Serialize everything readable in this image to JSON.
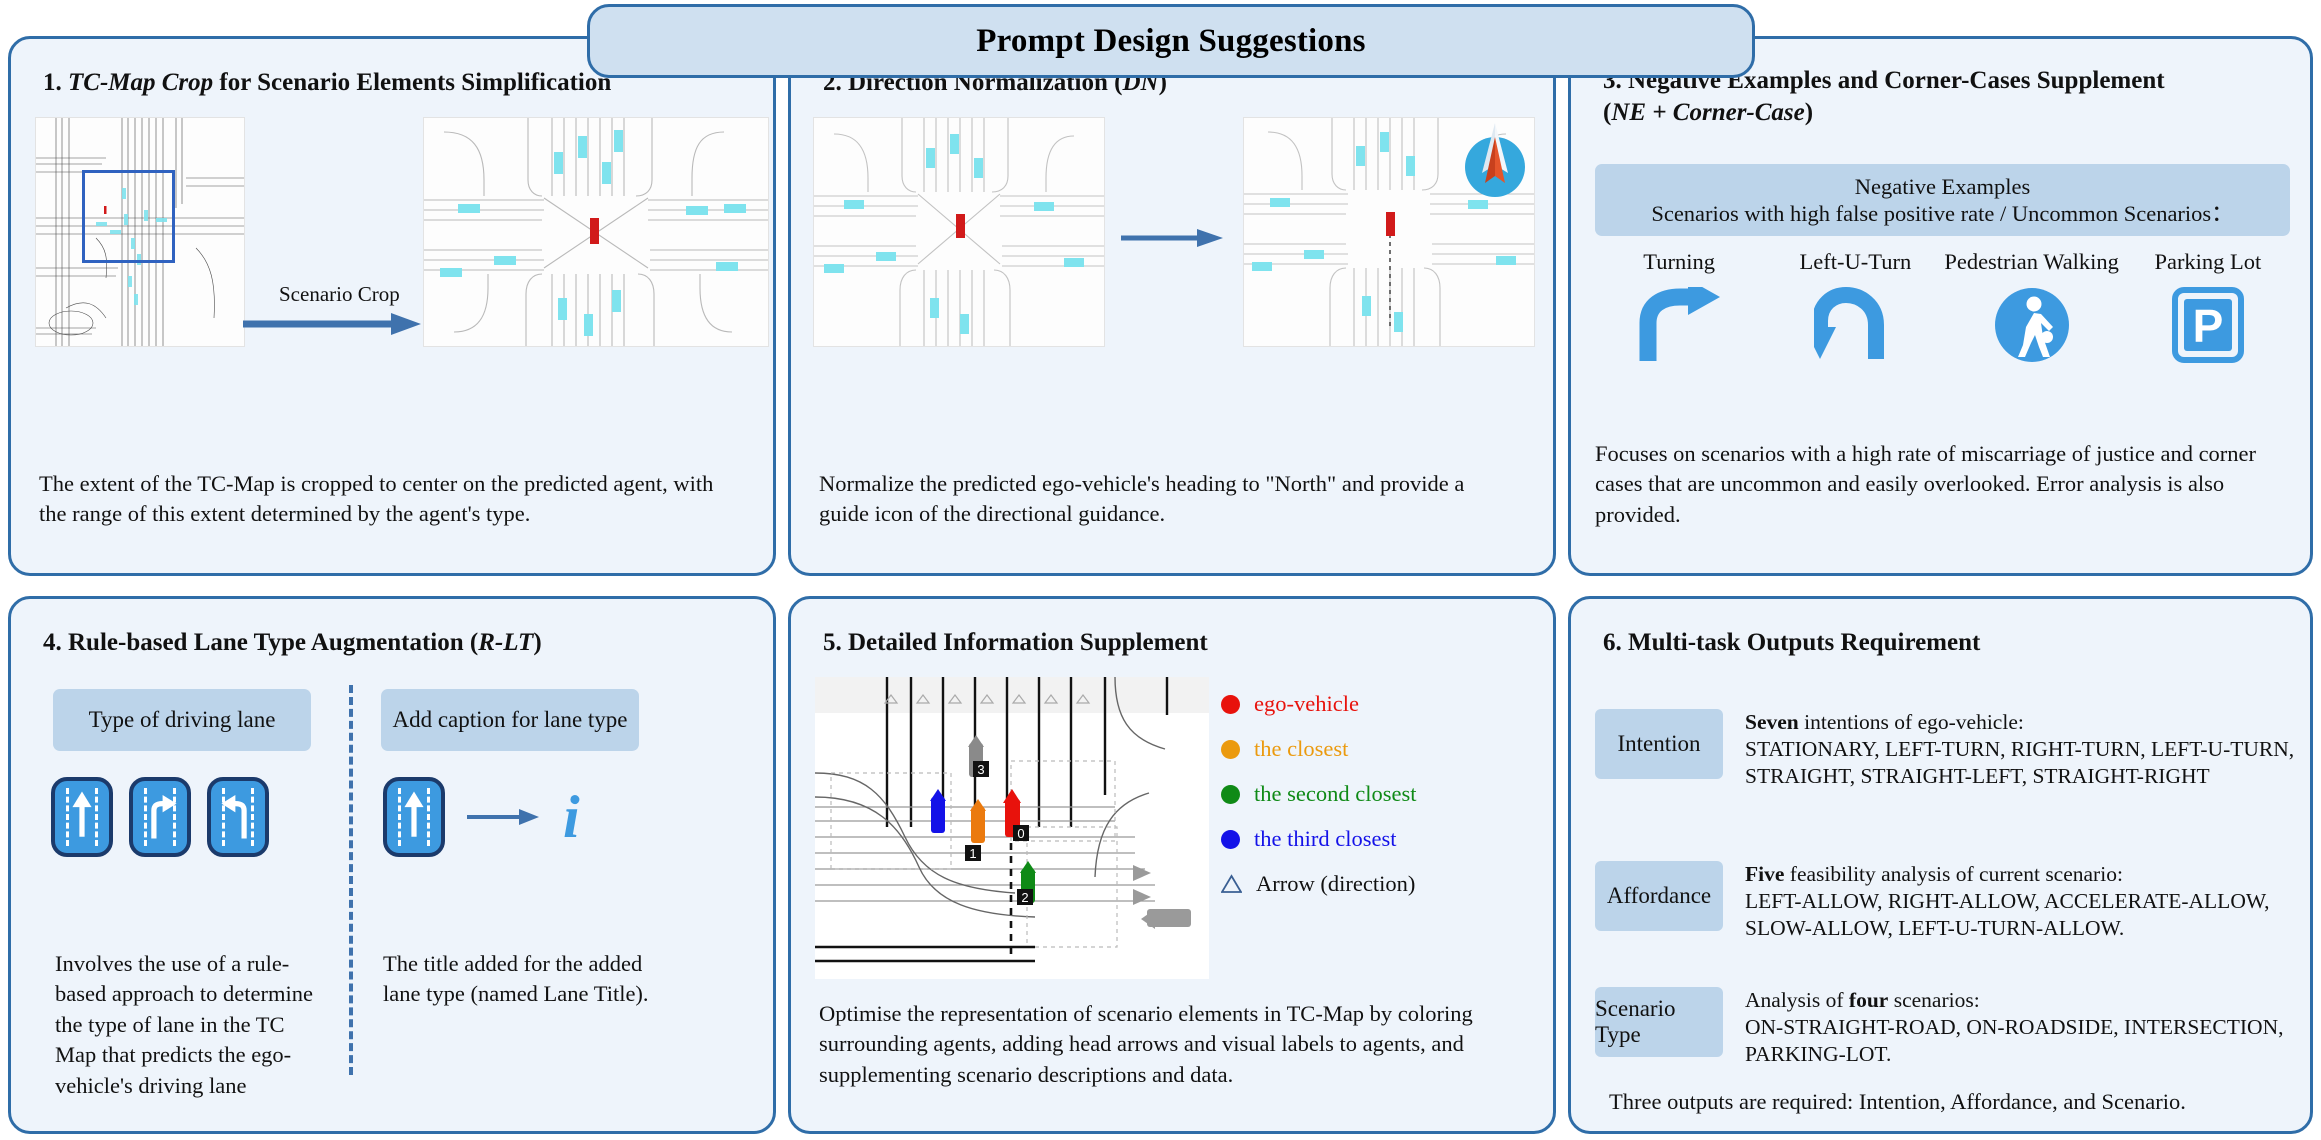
{
  "header": {
    "title": "Prompt Design Suggestions"
  },
  "panels": {
    "p1": {
      "title_num": "1.",
      "title_ital": "TC-Map Crop",
      "title_rest": "for Scenario Elements Simplification",
      "crop_label": "Scenario Crop",
      "caption": "The extent of the TC-Map is cropped to center on the predicted agent, with the range of this extent determined by the agent's type."
    },
    "p2": {
      "title_num": "2.",
      "title_rest": "Direction Normalization (",
      "title_ital": "DN",
      "title_tail": ")",
      "caption": "Normalize the predicted ego-vehicle's heading to \"North\" and provide a guide icon of the directional guidance."
    },
    "p3": {
      "title_num": "3.",
      "title_rest": "Negative Examples and Corner-Cases Supplement",
      "title_line2_open": "(",
      "title_line2_ital": "NE + Corner-Case",
      "title_line2_close": ")",
      "box_line1": "Negative Examples",
      "box_line2": "Scenarios with high false positive rate / Uncommon Scenarios：",
      "icons": [
        {
          "label": "Turning",
          "icon": "turn-right-arrow-icon"
        },
        {
          "label": "Left-U-Turn",
          "icon": "left-u-turn-arrow-icon"
        },
        {
          "label": "Pedestrian Walking",
          "icon": "pedestrian-walking-icon"
        },
        {
          "label": "Parking Lot",
          "icon": "parking-sign-icon"
        }
      ],
      "caption": "Focuses on scenarios with a high rate of miscarriage of justice and corner cases that are uncommon and easily overlooked. Error analysis is also provided."
    },
    "p4": {
      "title_num": "4.",
      "title_rest": "Rule-based Lane Type Augmentation (",
      "title_ital": "R-LT",
      "title_tail": ")",
      "sub_left": "Type of driving lane",
      "sub_right": "Add caption for lane type",
      "lane_icons_left": [
        "lane-straight-icon",
        "lane-right-turn-icon",
        "lane-left-turn-icon"
      ],
      "lane_icons_right": [
        "lane-straight-icon",
        "right-arrow-icon",
        "info-italic-i-icon"
      ],
      "caption_left": "Involves the use of a rule-based approach to determine the type of lane in the TC Map that predicts the ego-vehicle's driving lane",
      "caption_right": "The title added for the added lane type (named Lane Title)."
    },
    "p5": {
      "title_num": "5.",
      "title_rest": "Detailed Information Supplement",
      "legend": [
        {
          "label": "ego-vehicle",
          "color": "#e8120c",
          "shape": "circle"
        },
        {
          "label": "the closest",
          "color": "#eb9a0e",
          "shape": "circle"
        },
        {
          "label": "the second closest",
          "color": "#0f8a16",
          "shape": "circle"
        },
        {
          "label": "the third closest",
          "color": "#1412e8",
          "shape": "circle"
        },
        {
          "label": "Arrow (direction)",
          "color": "#3a5f93",
          "shape": "triangle"
        }
      ],
      "agent_labels": [
        "0",
        "1",
        "2",
        "3"
      ],
      "caption": "Optimise the representation of scenario elements in TC-Map by coloring surrounding agents, adding head arrows and visual labels to agents, and supplementing scenario descriptions and data."
    },
    "p6": {
      "title_num": "6.",
      "title_rest": "Multi-task Outputs Requirement",
      "rows": [
        {
          "tag": "Intention",
          "lead_bold": "Seven",
          "lead_rest": " intentions of ego-vehicle:",
          "body": "STATIONARY,  LEFT-TURN, RIGHT-TURN, LEFT-U-TURN, STRAIGHT, STRAIGHT-LEFT, STRAIGHT-RIGHT"
        },
        {
          "tag": "Affordance",
          "lead_bold": "Five",
          "lead_rest": " feasibility analysis of current scenario:",
          "body": "LEFT-ALLOW, RIGHT-ALLOW, ACCELERATE-ALLOW, SLOW-ALLOW, LEFT-U-TURN-ALLOW."
        },
        {
          "tag": "Scenario Type",
          "lead_pre": "Analysis of ",
          "lead_bold": "four",
          "lead_rest": " scenarios:",
          "body": "ON-STRAIGHT-ROAD, ON-ROADSIDE, INTERSECTION, PARKING-LOT."
        }
      ],
      "final_note": "Three outputs are required: Intention, Affordance, and Scenario."
    }
  },
  "colors": {
    "panel_border": "#2f6da8",
    "panel_fill": "#eef4fb",
    "accent_box": "#bcd4ea",
    "header_fill": "#cfe0f0",
    "icon_blue": "#3d9ae0",
    "arrow_blue": "#3f72ad"
  }
}
